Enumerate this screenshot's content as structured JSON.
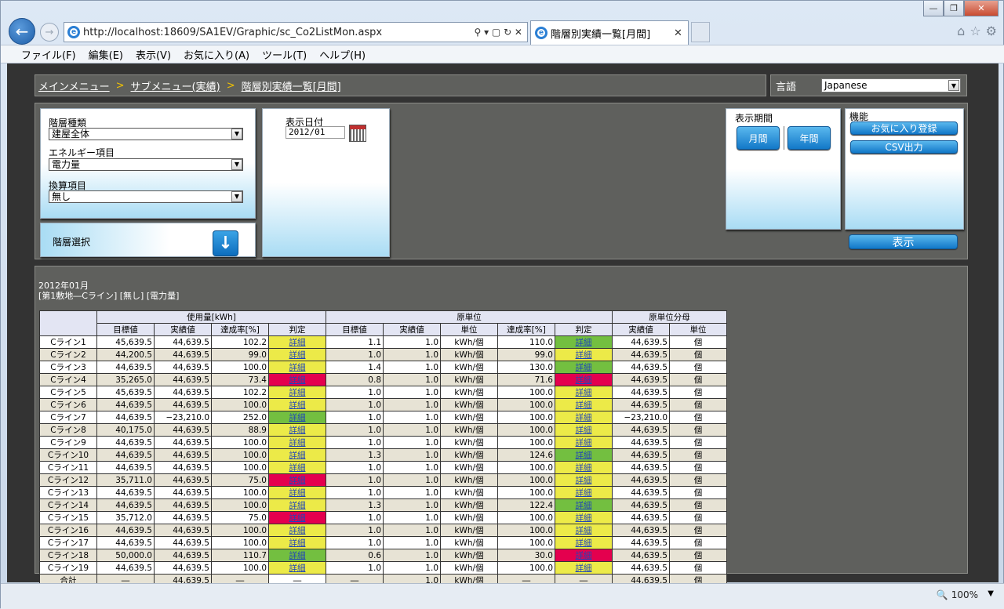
{
  "browser": {
    "url": "http://localhost:18609/SA1EV/Graphic/sc_Co2ListMon.aspx",
    "tab_title": "階層別実績一覧[月間]",
    "zoom": "100%"
  },
  "menu": [
    "ファイル(F)",
    "編集(E)",
    "表示(V)",
    "お気に入り(A)",
    "ツール(T)",
    "ヘルプ(H)"
  ],
  "breadcrumb": [
    "メインメニュー",
    "サブメニュー(実績)",
    "階層別実績一覧[月間]"
  ],
  "breadcrumb_sep": ">",
  "language": {
    "label": "言語",
    "value": "Japanese"
  },
  "filters": {
    "hier_type_label": "階層種類",
    "hier_type_value": "建屋全体",
    "energy_label": "エネルギー項目",
    "energy_value": "電力量",
    "conv_label": "換算項目",
    "conv_value": "無し",
    "hier_select_label": "階層選択"
  },
  "date": {
    "label": "表示日付",
    "value": "2012/01"
  },
  "period": {
    "label": "表示期間",
    "monthly": "月間",
    "yearly": "年間"
  },
  "functions": {
    "label": "機能",
    "favorite": "お気に入り登録",
    "csv": "CSV出力"
  },
  "show_button": "表示",
  "result": {
    "line1": "2012年01月",
    "line2": "[第1敷地―Cライン] [無し] [電力量]"
  },
  "table": {
    "groups": [
      "使用量[kWh]",
      "原単位",
      "原単位分母"
    ],
    "cols": [
      "目標値",
      "実績値",
      "達成率[%]",
      "判定",
      "目標値",
      "実績値",
      "単位",
      "達成率[%]",
      "判定",
      "実績値",
      "単位"
    ],
    "judge_text": "詳細",
    "unit1": "kWh/個",
    "unit2": "個",
    "rows": [
      {
        "name": "Cライン1",
        "t1": "45,639.5",
        "a1": "44,639.5",
        "r1": "102.2",
        "j1": "y",
        "t2": "1.1",
        "a2": "1.0",
        "r2": "110.0",
        "j2": "g",
        "a3": "44,639.5"
      },
      {
        "name": "Cライン2",
        "t1": "44,200.5",
        "a1": "44,639.5",
        "r1": "99.0",
        "j1": "y",
        "t2": "1.0",
        "a2": "1.0",
        "r2": "99.0",
        "j2": "y",
        "a3": "44,639.5"
      },
      {
        "name": "Cライン3",
        "t1": "44,639.5",
        "a1": "44,639.5",
        "r1": "100.0",
        "j1": "y",
        "t2": "1.4",
        "a2": "1.0",
        "r2": "130.0",
        "j2": "g",
        "a3": "44,639.5"
      },
      {
        "name": "Cライン4",
        "t1": "35,265.0",
        "a1": "44,639.5",
        "r1": "73.4",
        "j1": "r",
        "t2": "0.8",
        "a2": "1.0",
        "r2": "71.6",
        "j2": "r",
        "a3": "44,639.5"
      },
      {
        "name": "Cライン5",
        "t1": "45,639.5",
        "a1": "44,639.5",
        "r1": "102.2",
        "j1": "y",
        "t2": "1.0",
        "a2": "1.0",
        "r2": "100.0",
        "j2": "y",
        "a3": "44,639.5"
      },
      {
        "name": "Cライン6",
        "t1": "44,639.5",
        "a1": "44,639.5",
        "r1": "100.0",
        "j1": "y",
        "t2": "1.0",
        "a2": "1.0",
        "r2": "100.0",
        "j2": "y",
        "a3": "44,639.5"
      },
      {
        "name": "Cライン7",
        "t1": "44,639.5",
        "a1": "−23,210.0",
        "r1": "252.0",
        "j1": "g",
        "t2": "1.0",
        "a2": "1.0",
        "r2": "100.0",
        "j2": "y",
        "a3": "−23,210.0"
      },
      {
        "name": "Cライン8",
        "t1": "40,175.0",
        "a1": "44,639.5",
        "r1": "88.9",
        "j1": "y",
        "t2": "1.0",
        "a2": "1.0",
        "r2": "100.0",
        "j2": "y",
        "a3": "44,639.5"
      },
      {
        "name": "Cライン9",
        "t1": "44,639.5",
        "a1": "44,639.5",
        "r1": "100.0",
        "j1": "y",
        "t2": "1.0",
        "a2": "1.0",
        "r2": "100.0",
        "j2": "y",
        "a3": "44,639.5"
      },
      {
        "name": "Cライン10",
        "t1": "44,639.5",
        "a1": "44,639.5",
        "r1": "100.0",
        "j1": "y",
        "t2": "1.3",
        "a2": "1.0",
        "r2": "124.6",
        "j2": "g",
        "a3": "44,639.5"
      },
      {
        "name": "Cライン11",
        "t1": "44,639.5",
        "a1": "44,639.5",
        "r1": "100.0",
        "j1": "y",
        "t2": "1.0",
        "a2": "1.0",
        "r2": "100.0",
        "j2": "y",
        "a3": "44,639.5"
      },
      {
        "name": "Cライン12",
        "t1": "35,711.0",
        "a1": "44,639.5",
        "r1": "75.0",
        "j1": "r",
        "t2": "1.0",
        "a2": "1.0",
        "r2": "100.0",
        "j2": "y",
        "a3": "44,639.5"
      },
      {
        "name": "Cライン13",
        "t1": "44,639.5",
        "a1": "44,639.5",
        "r1": "100.0",
        "j1": "y",
        "t2": "1.0",
        "a2": "1.0",
        "r2": "100.0",
        "j2": "y",
        "a3": "44,639.5"
      },
      {
        "name": "Cライン14",
        "t1": "44,639.5",
        "a1": "44,639.5",
        "r1": "100.0",
        "j1": "y",
        "t2": "1.3",
        "a2": "1.0",
        "r2": "122.4",
        "j2": "g",
        "a3": "44,639.5"
      },
      {
        "name": "Cライン15",
        "t1": "35,712.0",
        "a1": "44,639.5",
        "r1": "75.0",
        "j1": "r",
        "t2": "1.0",
        "a2": "1.0",
        "r2": "100.0",
        "j2": "y",
        "a3": "44,639.5"
      },
      {
        "name": "Cライン16",
        "t1": "44,639.5",
        "a1": "44,639.5",
        "r1": "100.0",
        "j1": "y",
        "t2": "1.0",
        "a2": "1.0",
        "r2": "100.0",
        "j2": "y",
        "a3": "44,639.5"
      },
      {
        "name": "Cライン17",
        "t1": "44,639.5",
        "a1": "44,639.5",
        "r1": "100.0",
        "j1": "y",
        "t2": "1.0",
        "a2": "1.0",
        "r2": "100.0",
        "j2": "y",
        "a3": "44,639.5"
      },
      {
        "name": "Cライン18",
        "t1": "50,000.0",
        "a1": "44,639.5",
        "r1": "110.7",
        "j1": "g",
        "t2": "0.6",
        "a2": "1.0",
        "r2": "30.0",
        "j2": "r",
        "a3": "44,639.5"
      },
      {
        "name": "Cライン19",
        "t1": "44,639.5",
        "a1": "44,639.5",
        "r1": "100.0",
        "j1": "y",
        "t2": "1.0",
        "a2": "1.0",
        "r2": "100.0",
        "j2": "y",
        "a3": "44,639.5"
      }
    ],
    "total": {
      "name": "合計",
      "t1": "―",
      "a1": "44,639.5",
      "r1": "―",
      "j1": "―",
      "t2": "―",
      "a2": "1.0",
      "r2": "―",
      "j2": "―",
      "a3": "44,639.5"
    }
  }
}
